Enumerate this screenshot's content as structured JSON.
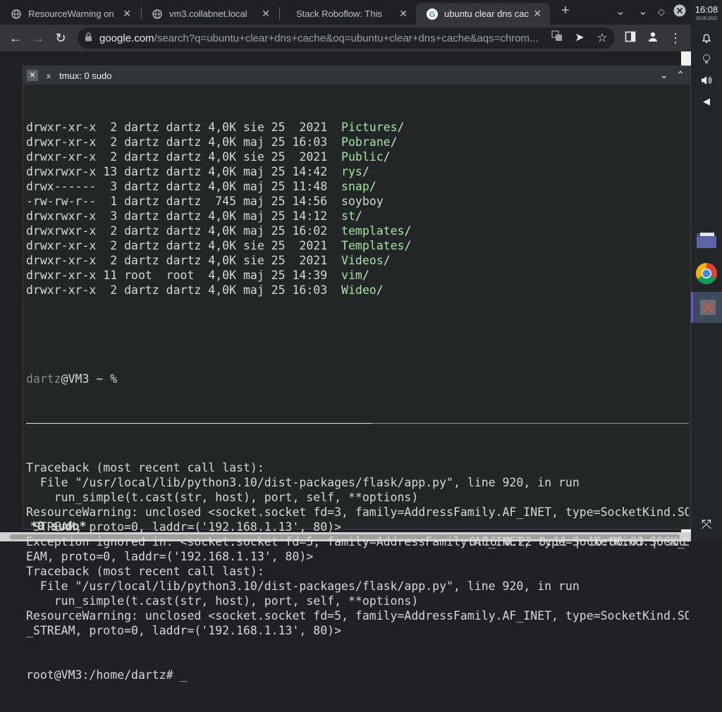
{
  "browser": {
    "tabs": [
      {
        "title": "ResourceWarning on",
        "active": false
      },
      {
        "title": "vm3.collabnet.local",
        "active": false
      },
      {
        "title": "Stack Roboflow: This",
        "active": false
      },
      {
        "title": "ubuntu clear dns cac",
        "active": true
      }
    ],
    "new_tab_label": "+",
    "url_host": "google.com",
    "url_rest": "/search?q=ubuntu+clear+dns+cache&oq=ubuntu+clear+dns+cache&aqs=chrom..."
  },
  "panel": {
    "time": "16:08",
    "date": "25.05.2022"
  },
  "terminal": {
    "window_title": "tmux: 0 sudo",
    "listing": [
      {
        "meta": "drwxr-xr-x  2 dartz dartz 4,0K sie 25  2021  ",
        "name": "Pictures",
        "suffix": "/",
        "is_dir": true
      },
      {
        "meta": "drwxr-xr-x  2 dartz dartz 4,0K maj 25 16:03  ",
        "name": "Pobrane",
        "suffix": "/",
        "is_dir": true
      },
      {
        "meta": "drwxr-xr-x  2 dartz dartz 4,0K sie 25  2021  ",
        "name": "Public",
        "suffix": "/",
        "is_dir": true
      },
      {
        "meta": "drwxrwxr-x 13 dartz dartz 4,0K maj 25 14:42  ",
        "name": "rys",
        "suffix": "/",
        "is_dir": true
      },
      {
        "meta": "drwx------  3 dartz dartz 4,0K maj 25 11:48  ",
        "name": "snap",
        "suffix": "/",
        "is_dir": true
      },
      {
        "meta": "-rw-rw-r--  1 dartz dartz  745 maj 25 14:56  ",
        "name": "soyboy",
        "suffix": "",
        "is_dir": false
      },
      {
        "meta": "drwxrwxr-x  3 dartz dartz 4,0K maj 25 14:12  ",
        "name": "st",
        "suffix": "/",
        "is_dir": true
      },
      {
        "meta": "drwxrwxr-x  2 dartz dartz 4,0K maj 25 16:02  ",
        "name": "templates",
        "suffix": "/",
        "is_dir": true
      },
      {
        "meta": "drwxr-xr-x  2 dartz dartz 4,0K sie 25  2021  ",
        "name": "Templates",
        "suffix": "/",
        "is_dir": true
      },
      {
        "meta": "drwxr-xr-x  2 dartz dartz 4,0K sie 25  2021  ",
        "name": "Videos",
        "suffix": "/",
        "is_dir": true
      },
      {
        "meta": "drwxr-xr-x 11 root  root  4,0K maj 25 14:39  ",
        "name": "vim",
        "suffix": "/",
        "is_dir": true
      },
      {
        "meta": "drwxr-xr-x  2 dartz dartz 4,0K maj 25 16:03  ",
        "name": "Wideo",
        "suffix": "/",
        "is_dir": true
      }
    ],
    "prompt_user": "dartz",
    "prompt_rest": "@VM3 ~ %",
    "output_lines": [
      "Traceback (most recent call last):",
      "  File \"/usr/local/lib/python3.10/dist-packages/flask/app.py\", line 920, in run",
      "    run_simple(t.cast(str, host), port, self, **options)",
      "ResourceWarning: unclosed <socket.socket fd=3, family=AddressFamily.AF_INET, type=SocketKind.SOC",
      "_STREAM, proto=0, laddr=('192.168.1.13', 80)>",
      "Exception ignored in: <socket.socket fd=5, family=AddressFamily.AF_INET, type=SocketKind.SOCK_S",
      "EAM, proto=0, laddr=('192.168.1.13', 80)>",
      "Traceback (most recent call last):",
      "  File \"/usr/local/lib/python3.10/dist-packages/flask/app.py\", line 920, in run",
      "    run_simple(t.cast(str, host), port, self, **options)",
      "ResourceWarning: unclosed <socket.socket fd=5, family=AddressFamily.AF_INET, type=SocketKind.SO",
      "_STREAM, proto=0, laddr=('192.168.1.13', 80)>"
    ],
    "root_prompt": "root@VM3:/home/dartz# _",
    "status_window": "*0 sudo*",
    "status_right": "0.16 0.22 0.11 | 16:08:03 | sud"
  },
  "colors": {
    "dir": "#a6e3a1",
    "prompt_user": "#8a8a8a"
  }
}
